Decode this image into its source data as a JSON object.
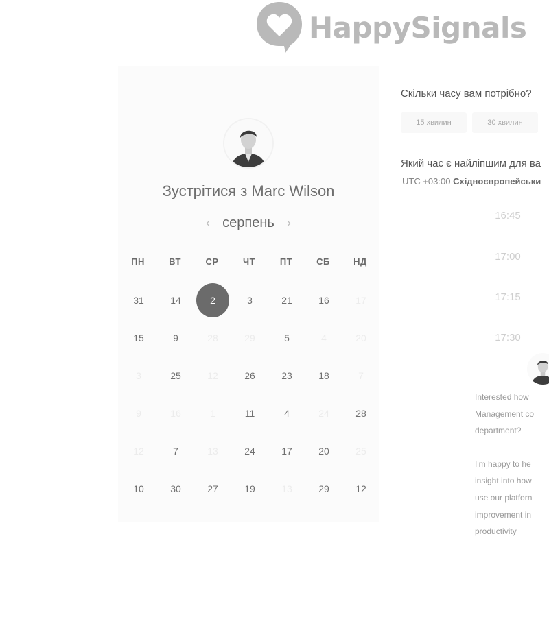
{
  "logo": {
    "text": "HappySignals"
  },
  "calendar": {
    "title_prefix": "Зустрітися з",
    "host_name": "Marc Wilson",
    "month": "серпень",
    "prev_icon": "‹",
    "next_icon": "›",
    "weekdays": [
      "ПН",
      "ВТ",
      "СР",
      "ЧТ",
      "ПТ",
      "СБ",
      "НД"
    ],
    "rows": [
      [
        {
          "d": "31"
        },
        {
          "d": "14"
        },
        {
          "d": "2",
          "selected": true
        },
        {
          "d": "3"
        },
        {
          "d": "21"
        },
        {
          "d": "16"
        },
        {
          "d": "17",
          "dim": true
        }
      ],
      [
        {
          "d": "15"
        },
        {
          "d": "9"
        },
        {
          "d": "28",
          "dim": true
        },
        {
          "d": "29",
          "dim": true
        },
        {
          "d": "5"
        },
        {
          "d": "4",
          "dim": true
        },
        {
          "d": "20",
          "dim": true
        }
      ],
      [
        {
          "d": "3",
          "dim": true
        },
        {
          "d": "25"
        },
        {
          "d": "12",
          "dim": true
        },
        {
          "d": "26"
        },
        {
          "d": "23"
        },
        {
          "d": "18"
        },
        {
          "d": "7",
          "dim": true
        }
      ],
      [
        {
          "d": "9",
          "dim": true
        },
        {
          "d": "16",
          "dim": true
        },
        {
          "d": "1",
          "dim": true
        },
        {
          "d": "11"
        },
        {
          "d": "4"
        },
        {
          "d": "24",
          "dim": true
        },
        {
          "d": "28"
        }
      ],
      [
        {
          "d": "12",
          "dim": true
        },
        {
          "d": "7"
        },
        {
          "d": "13",
          "dim": true
        },
        {
          "d": "24"
        },
        {
          "d": "17"
        },
        {
          "d": "20"
        },
        {
          "d": "25",
          "dim": true
        }
      ],
      [
        {
          "d": "10"
        },
        {
          "d": "30"
        },
        {
          "d": "27"
        },
        {
          "d": "19"
        },
        {
          "d": "13",
          "dim": true
        },
        {
          "d": "29"
        },
        {
          "d": "12"
        }
      ]
    ]
  },
  "booking": {
    "duration_question": "Скільки часу вам потрібно?",
    "durations": [
      "15 хвилин",
      "30 хвилин"
    ],
    "time_question": "Який час є найліпшим для ва",
    "timezone_prefix": "UTC +03:00",
    "timezone_name": "Східноєвропейськи",
    "slots": [
      "16:45",
      "17:00",
      "17:15",
      "17:30"
    ]
  },
  "chat": {
    "message_lines_1": [
      "Interested how",
      "Management co",
      "department?"
    ],
    "message_lines_2": [
      "I'm happy to he",
      "insight into how",
      "use our platforn",
      "improvement in",
      "productivity"
    ]
  },
  "colors": {
    "selected_day": "#6b6b6b",
    "logo": "#b9b9b9"
  }
}
